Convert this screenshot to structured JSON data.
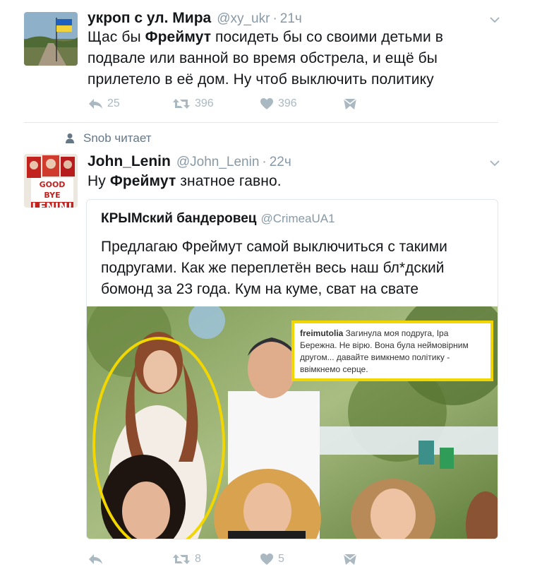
{
  "tweets": [
    {
      "name": "укроп с ул. Мира",
      "handle": "@xy_ukr",
      "sep": "·",
      "time": "21ч",
      "text_pre": "Щас бы ",
      "text_bold": "Фреймут",
      "text_post": " посидеть бы со своими детьми в подвале или ванной во время обстрела, и ещё бы прилетело в её дом. Ну чтоб выключить политику",
      "reply_count": "25",
      "retweet_count": "396",
      "like_count": "396"
    },
    {
      "context": "Snob читает",
      "name": "John_Lenin",
      "handle": "@John_Lenin",
      "sep": "·",
      "time": "22ч",
      "avatar_text_1": "GOOD BYE",
      "avatar_text_2": "LENIN!",
      "text_pre": "Ну ",
      "text_bold": "Фреймут",
      "text_post": " знатное гавно.",
      "reply_count": "",
      "retweet_count": "8",
      "like_count": "5"
    }
  ],
  "quoted": {
    "name": "КРЫМский бандеровец",
    "handle": "@CrimeaUA1",
    "text": "Предлагаю Фреймут самой выключиться с такими подругами. Как же переплетён весь наш бл*дский бомонд за 23 года. Кум на куме, сват на свате",
    "caption_user": "freimutolia",
    "caption_text": " Загинула моя подруга, Іра Бережна. Не вірю. Вона була неймовірним другом... давайте вимкнемо політику - ввімкнемо серце."
  },
  "colors": {
    "accent_gray": "#aab8c2",
    "text": "#14171a",
    "muted": "#8899a6",
    "highlight": "#f2d600"
  },
  "icons": [
    "ukraine-flag-avatar",
    "chevron-down-icon",
    "reply-icon",
    "retweet-icon",
    "heart-icon",
    "direct-message-icon",
    "person-icon",
    "goodbye-lenin-avatar"
  ]
}
